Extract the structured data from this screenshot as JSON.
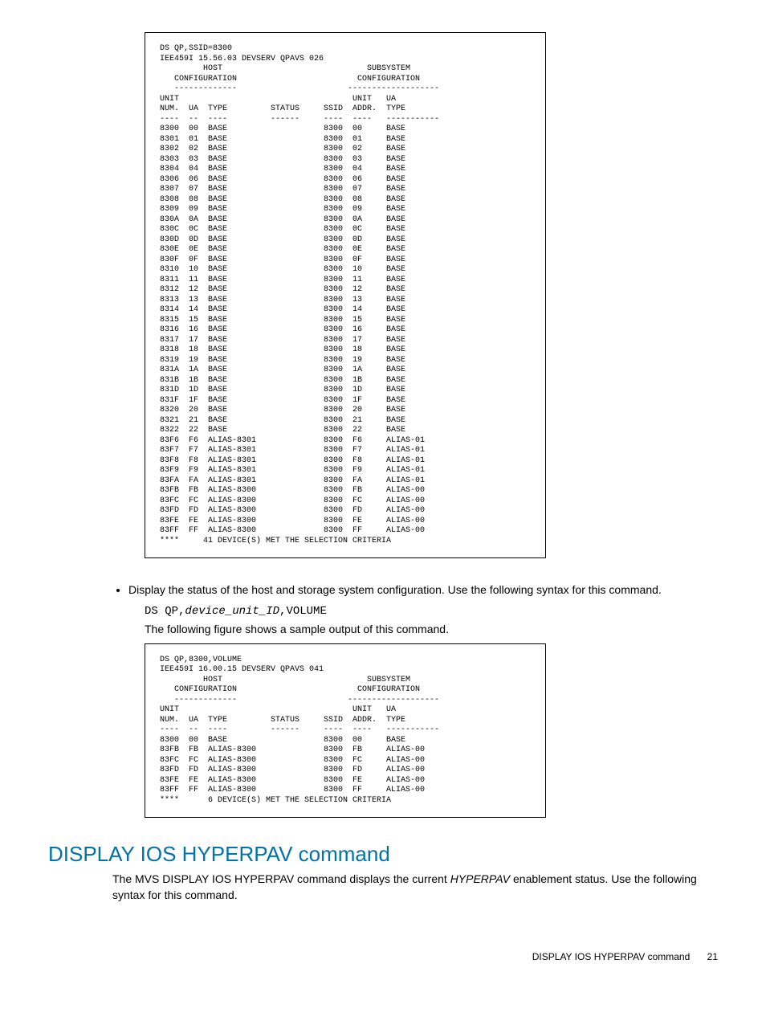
{
  "box1": {
    "cmd": "DS QP,SSID=8300",
    "hdr": "IEE459I 15.56.03 DEVSERV QPAVS 026",
    "host_label": "         HOST                              SUBSYSTEM",
    "conf_label": "   CONFIGURATION                         CONFIGURATION",
    "dash1": "   -------------                       -------------------",
    "unit_hdr": "UNIT                                    UNIT   UA",
    "cols": "NUM.  UA  TYPE         STATUS     SSID  ADDR.  TYPE",
    "dash2": "----  --  ----         ------     ----  ----   -----------",
    "rows": [
      "8300  00  BASE                    8300  00     BASE",
      "8301  01  BASE                    8300  01     BASE",
      "8302  02  BASE                    8300  02     BASE",
      "8303  03  BASE                    8300  03     BASE",
      "8304  04  BASE                    8300  04     BASE",
      "8306  06  BASE                    8300  06     BASE",
      "8307  07  BASE                    8300  07     BASE",
      "8308  08  BASE                    8300  08     BASE",
      "8309  09  BASE                    8300  09     BASE",
      "830A  0A  BASE                    8300  0A     BASE",
      "830C  0C  BASE                    8300  0C     BASE",
      "830D  0D  BASE                    8300  0D     BASE",
      "830E  0E  BASE                    8300  0E     BASE",
      "830F  0F  BASE                    8300  0F     BASE",
      "8310  10  BASE                    8300  10     BASE",
      "8311  11  BASE                    8300  11     BASE",
      "8312  12  BASE                    8300  12     BASE",
      "8313  13  BASE                    8300  13     BASE",
      "8314  14  BASE                    8300  14     BASE",
      "8315  15  BASE                    8300  15     BASE",
      "8316  16  BASE                    8300  16     BASE",
      "8317  17  BASE                    8300  17     BASE",
      "8318  18  BASE                    8300  18     BASE",
      "8319  19  BASE                    8300  19     BASE",
      "831A  1A  BASE                    8300  1A     BASE",
      "831B  1B  BASE                    8300  1B     BASE",
      "831D  1D  BASE                    8300  1D     BASE",
      "831F  1F  BASE                    8300  1F     BASE",
      "8320  20  BASE                    8300  20     BASE",
      "8321  21  BASE                    8300  21     BASE",
      "8322  22  BASE                    8300  22     BASE",
      "83F6  F6  ALIAS-8301              8300  F6     ALIAS-01",
      "83F7  F7  ALIAS-8301              8300  F7     ALIAS-01",
      "83F8  F8  ALIAS-8301              8300  F8     ALIAS-01",
      "83F9  F9  ALIAS-8301              8300  F9     ALIAS-01",
      "83FA  FA  ALIAS-8301              8300  FA     ALIAS-01",
      "83FB  FB  ALIAS-8300              8300  FB     ALIAS-00",
      "83FC  FC  ALIAS-8300              8300  FC     ALIAS-00",
      "83FD  FD  ALIAS-8300              8300  FD     ALIAS-00",
      "83FE  FE  ALIAS-8300              8300  FE     ALIAS-00",
      "83FF  FF  ALIAS-8300              8300  FF     ALIAS-00"
    ],
    "footer": "****     41 DEVICE(S) MET THE SELECTION CRITERIA"
  },
  "bullet1": "Display the status of the host and storage system configuration. Use the following syntax for this command.",
  "cmd_line_pre": "DS QP,",
  "cmd_line_var": "device_unit_ID",
  "cmd_line_post": ",VOLUME",
  "sample_text": "The following figure shows a sample output of this command.",
  "box2": {
    "cmd": "DS QP,8300,VOLUME",
    "hdr": "IEE459I 16.00.15 DEVSERV QPAVS 041",
    "host_label": "         HOST                              SUBSYSTEM",
    "conf_label": "   CONFIGURATION                         CONFIGURATION",
    "dash1": "   -------------                       -------------------",
    "unit_hdr": "UNIT                                    UNIT   UA",
    "cols": "NUM.  UA  TYPE         STATUS     SSID  ADDR.  TYPE",
    "dash2": "----  --  ----         ------     ----  ----   -----------",
    "rows": [
      "8300  00  BASE                    8300  00     BASE",
      "83FB  FB  ALIAS-8300              8300  FB     ALIAS-00",
      "83FC  FC  ALIAS-8300              8300  FC     ALIAS-00",
      "83FD  FD  ALIAS-8300              8300  FD     ALIAS-00",
      "83FE  FE  ALIAS-8300              8300  FE     ALIAS-00",
      "83FF  FF  ALIAS-8300              8300  FF     ALIAS-00"
    ],
    "footer": "****      6 DEVICE(S) MET THE SELECTION CRITERIA"
  },
  "section_title": "DISPLAY IOS HYPERPAV command",
  "section_body_1": "The MVS DISPLAY IOS HYPERPAV command displays the current ",
  "section_body_em": "HYPERPAV",
  "section_body_2": " enablement status. Use the following syntax for this command.",
  "footer_text": "DISPLAY IOS HYPERPAV command",
  "footer_page": "21"
}
